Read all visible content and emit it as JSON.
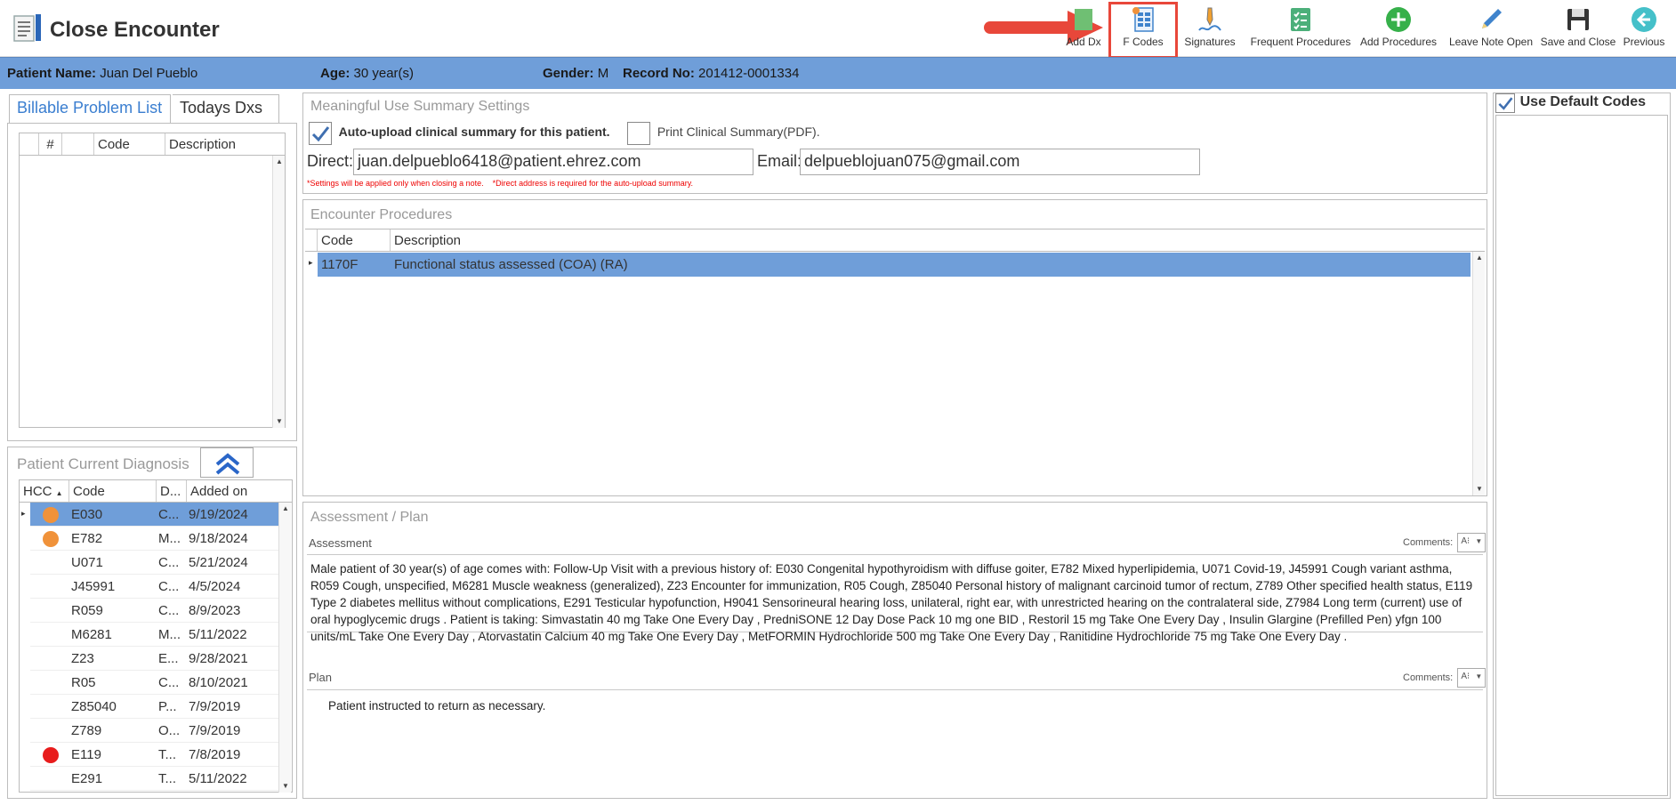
{
  "app": {
    "title": "Close Encounter"
  },
  "toolbar": {
    "add_dx": "Add Dx",
    "f_codes": "F Codes",
    "signatures": "Signatures",
    "frequent_procedures": "Frequent Procedures",
    "add_procedures": "Add Procedures",
    "leave_note_open": "Leave Note Open",
    "save_and_close": "Save and Close",
    "previous": "Previous"
  },
  "patient": {
    "name_label": "Patient Name:",
    "name": "Juan Del Pueblo",
    "age_label": "Age:",
    "age": "30 year(s)",
    "gender_label": "Gender:",
    "gender": "M",
    "record_label": "Record No:",
    "record": "201412-0001334"
  },
  "left_tabs": {
    "billable": "Billable Problem List",
    "todays": "Todays Dxs"
  },
  "problem_grid": {
    "col_num": "#",
    "col_code": "Code",
    "col_desc": "Description"
  },
  "diagnosis": {
    "title": "Patient Current Diagnosis",
    "col_hcc": "HCC",
    "col_code": "Code",
    "col_d": "D...",
    "col_added": "Added on",
    "rows": [
      {
        "code": "E030",
        "d": "C...",
        "added": "9/19/2024",
        "dot": "#f0923a"
      },
      {
        "code": "E782",
        "d": "M...",
        "added": "9/18/2024",
        "dot": "#f0923a"
      },
      {
        "code": "U071",
        "d": "C...",
        "added": "5/21/2024",
        "dot": ""
      },
      {
        "code": "J45991",
        "d": "C...",
        "added": "4/5/2024",
        "dot": ""
      },
      {
        "code": "R059",
        "d": "C...",
        "added": "8/9/2023",
        "dot": ""
      },
      {
        "code": "M6281",
        "d": "M...",
        "added": "5/11/2022",
        "dot": ""
      },
      {
        "code": "Z23",
        "d": "E...",
        "added": "9/28/2021",
        "dot": ""
      },
      {
        "code": "R05",
        "d": "C...",
        "added": "8/10/2021",
        "dot": ""
      },
      {
        "code": "Z85040",
        "d": "P...",
        "added": "7/9/2019",
        "dot": ""
      },
      {
        "code": "Z789",
        "d": "O...",
        "added": "7/9/2019",
        "dot": ""
      },
      {
        "code": "E119",
        "d": "T...",
        "added": "7/8/2019",
        "dot": "#e81c1c"
      },
      {
        "code": "E291",
        "d": "T...",
        "added": "5/11/2022",
        "dot": ""
      }
    ]
  },
  "mu_settings": {
    "title": "Meaningful Use Summary Settings",
    "auto_upload": "Auto-upload clinical summary for this patient.",
    "print_summary": "Print Clinical Summary(PDF).",
    "direct_label": "Direct:",
    "direct_value": "juan.delpueblo6418@patient.ehrez.com",
    "email_label": "Email:",
    "email_value": "delpueblojuan075@gmail.com",
    "note": "*Settings will be applied only when closing a note.    *Direct address is required for the auto-upload summary."
  },
  "procedures": {
    "title": "Encounter Procedures",
    "col_code": "Code",
    "col_desc": "Description",
    "rows": [
      {
        "code": "1170F",
        "desc": "Functional status assessed (COA) (RA)"
      }
    ]
  },
  "assessment_plan": {
    "title": "Assessment / Plan",
    "assessment_label": "Assessment",
    "comments_label": "Comments:",
    "assessment_text": "Male patient of 30 year(s) of age comes with: Follow-Up Visit  with a previous history of: E030 Congenital hypothyroidism with diffuse goiter, E782 Mixed hyperlipidemia, U071 Covid-19, J45991 Cough variant asthma, R059 Cough, unspecified, M6281 Muscle weakness (generalized), Z23 Encounter for immunization, R05 Cough, Z85040 Personal history of malignant carcinoid tumor of rectum, Z789 Other specified health status, E119 Type 2 diabetes mellitus without complications, E291 Testicular hypofunction, H9041 Sensorineural hearing loss, unilateral, right ear, with unrestricted hearing on the contralateral side, Z7984 Long term (current) use of oral hypoglycemic drugs .  Patient is taking: Simvastatin 40 mg Take One Every Day , PredniSONE 12 Day Dose Pack 10 mg one BID , Restoril 15 mg Take One Every Day , Insulin Glargine (Prefilled Pen) yfgn 100 units/mL Take One Every Day , Atorvastatin Calcium 40 mg Take One Every Day , MetFORMIN Hydrochloride 500 mg Take One Every Day , Ranitidine Hydrochloride 75 mg Take One Every Day  .",
    "plan_label": "Plan",
    "plan_text": "Patient instructed to return as necessary."
  },
  "right_panel": {
    "use_default_codes": "Use Default Codes"
  },
  "colors": {
    "accent": "#6f9ed9",
    "highlight_red": "#e8473a",
    "hcc_orange": "#f0923a",
    "hcc_red": "#e81c1c"
  }
}
